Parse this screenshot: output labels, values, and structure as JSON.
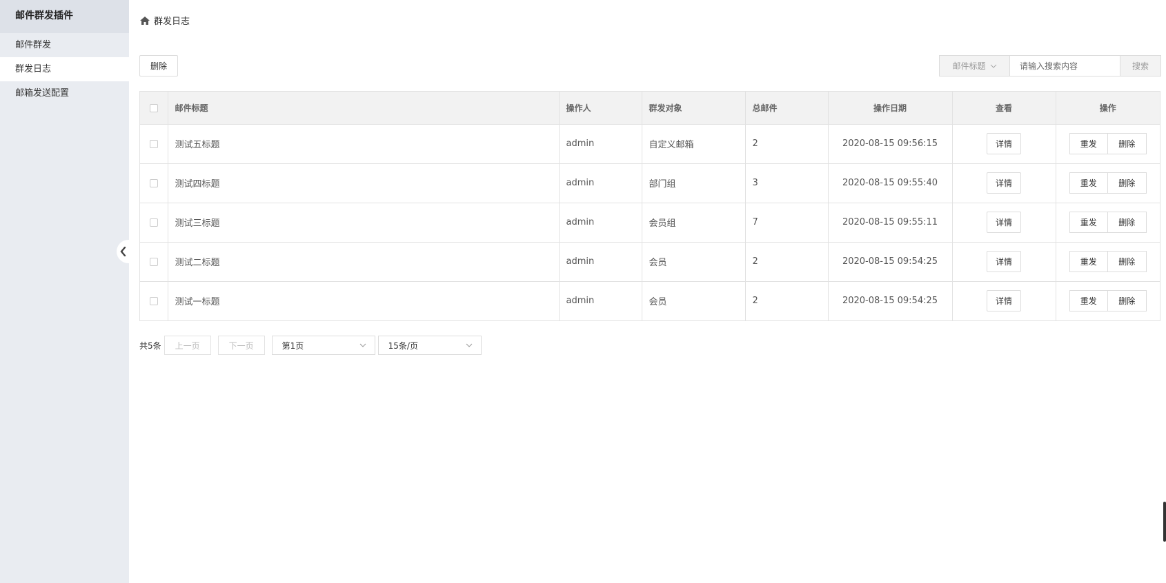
{
  "sidebar": {
    "title": "邮件群发插件",
    "items": [
      {
        "label": "邮件群发"
      },
      {
        "label": "群发日志"
      },
      {
        "label": "邮箱发送配置"
      }
    ]
  },
  "breadcrumb": {
    "icon": "home-icon",
    "label": "群发日志"
  },
  "toolbar": {
    "delete_label": "删除",
    "search_field": "邮件标题",
    "search_placeholder": "请输入搜索内容",
    "search_label": "搜索"
  },
  "table": {
    "headers": {
      "title": "邮件标题",
      "operator": "操作人",
      "target": "群发对象",
      "total": "总邮件",
      "date": "操作日期",
      "view": "查看",
      "action": "操作"
    },
    "rows": [
      {
        "title": "测试五标题",
        "operator": "admin",
        "target": "自定义邮箱",
        "total": "2",
        "date": "2020-08-15 09:56:15",
        "detail": "详情",
        "resend": "重发",
        "delete": "删除"
      },
      {
        "title": "测试四标题",
        "operator": "admin",
        "target": "部门组",
        "total": "3",
        "date": "2020-08-15 09:55:40",
        "detail": "详情",
        "resend": "重发",
        "delete": "删除"
      },
      {
        "title": "测试三标题",
        "operator": "admin",
        "target": "会员组",
        "total": "7",
        "date": "2020-08-15 09:55:11",
        "detail": "详情",
        "resend": "重发",
        "delete": "删除"
      },
      {
        "title": "测试二标题",
        "operator": "admin",
        "target": "会员",
        "total": "2",
        "date": "2020-08-15 09:54:25",
        "detail": "详情",
        "resend": "重发",
        "delete": "删除"
      },
      {
        "title": "测试一标题",
        "operator": "admin",
        "target": "会员",
        "total": "2",
        "date": "2020-08-15 09:54:25",
        "detail": "详情",
        "resend": "重发",
        "delete": "删除"
      }
    ]
  },
  "pagination": {
    "total": "共5条",
    "prev": "上一页",
    "next": "下一页",
    "page_select": "第1页",
    "size_select": "15条/页"
  },
  "colors": {
    "sidebar_bg": "#e9ecf1",
    "sidebar_header_bg": "#dde1e8",
    "table_header_bg": "#f2f2f2"
  }
}
